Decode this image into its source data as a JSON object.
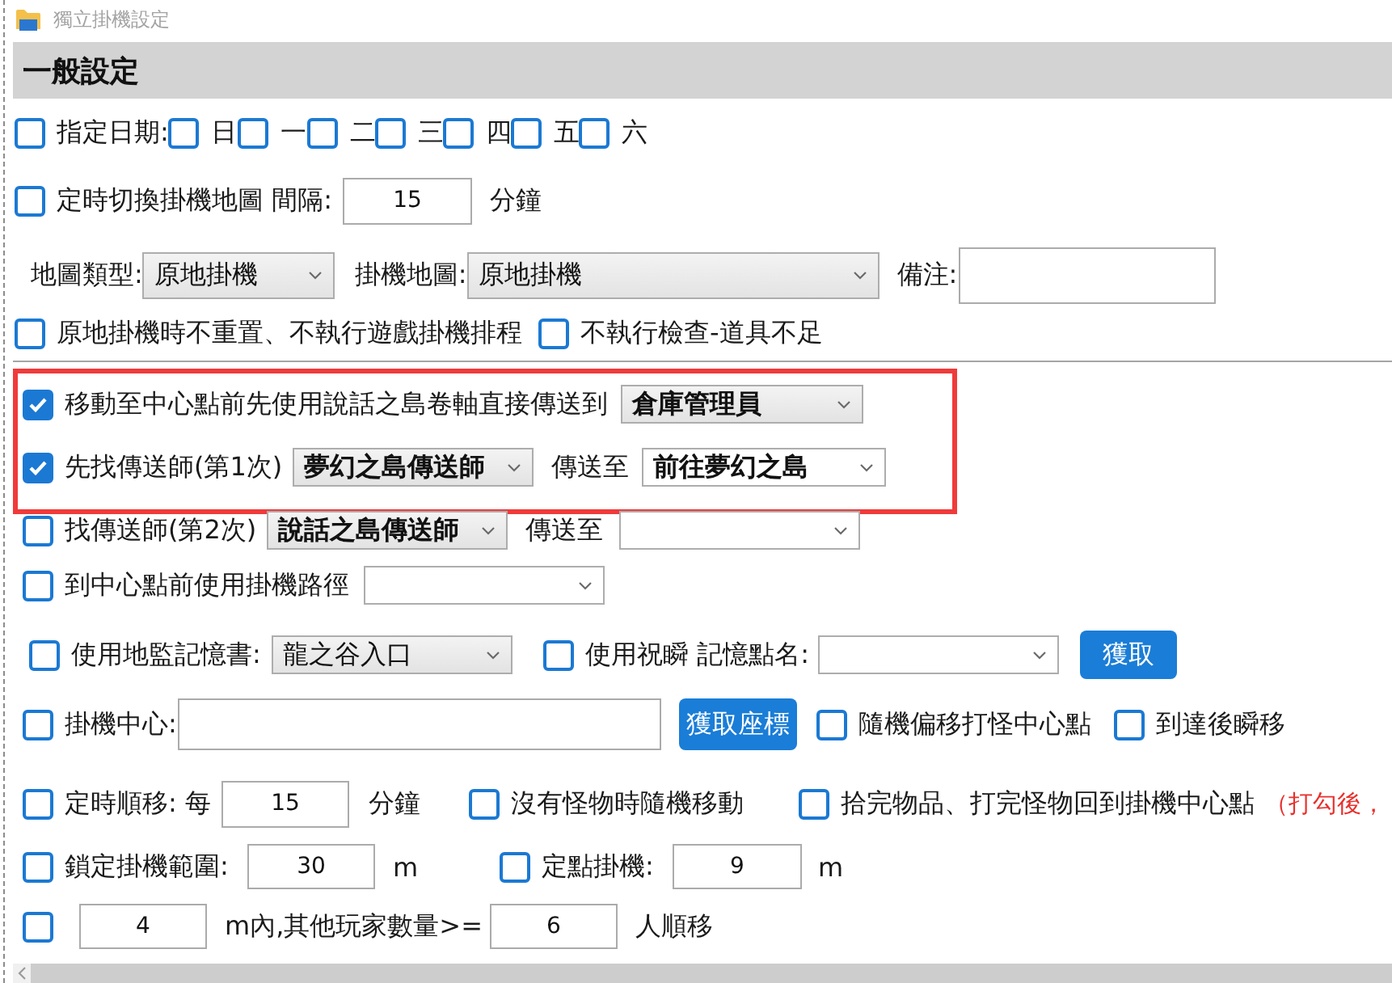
{
  "window": {
    "title": "獨立掛機設定"
  },
  "section": {
    "title": "一般設定"
  },
  "blocks": [
    {
      "highlighted": false,
      "rows": [
        {
          "items": [
            {
              "kind": "checkbox",
              "label": "指定日期:",
              "checked": false
            },
            {
              "kind": "checkbox",
              "label": "日",
              "checked": false
            },
            {
              "kind": "checkbox",
              "label": "一",
              "checked": false
            },
            {
              "kind": "checkbox",
              "label": "二",
              "checked": false
            },
            {
              "kind": "checkbox",
              "label": "三",
              "checked": false
            },
            {
              "kind": "checkbox",
              "label": "四",
              "checked": false
            },
            {
              "kind": "checkbox",
              "label": "五",
              "checked": false
            },
            {
              "kind": "checkbox",
              "label": "六",
              "checked": false
            }
          ]
        },
        {
          "items": [
            {
              "kind": "checkbox",
              "label": "定時切換掛機地圖 間隔:",
              "checked": false
            },
            {
              "kind": "input",
              "value": "15"
            },
            {
              "kind": "label",
              "text": "分鐘"
            }
          ]
        },
        {
          "items": [
            {
              "kind": "label",
              "text": "地圖類型:"
            },
            {
              "kind": "select",
              "value": "原地掛機",
              "bold": false,
              "editable": false
            },
            {
              "kind": "label",
              "text": "掛機地圖:"
            },
            {
              "kind": "select",
              "value": "原地掛機",
              "bold": false,
              "editable": false
            },
            {
              "kind": "label",
              "text": "備注:"
            },
            {
              "kind": "input"
            }
          ]
        },
        {
          "items": [
            {
              "kind": "checkbox",
              "label": "原地掛機時不重置、不執行遊戲掛機排程",
              "checked": false
            },
            {
              "kind": "checkbox",
              "label": "不執行檢查-道具不足",
              "checked": false
            }
          ]
        }
      ]
    },
    {
      "highlighted": true,
      "rows": [
        {
          "items": [
            {
              "kind": "checkbox",
              "label": "移動至中心點前先使用說話之島卷軸直接傳送到",
              "checked": true
            },
            {
              "kind": "select",
              "value": "倉庫管理員",
              "bold": true,
              "editable": false
            }
          ]
        },
        {
          "items": [
            {
              "kind": "checkbox",
              "label": "先找傳送師(第1次)",
              "checked": true
            },
            {
              "kind": "select",
              "value": "夢幻之島傳送師",
              "bold": true,
              "editable": false
            },
            {
              "kind": "label",
              "text": "傳送至"
            },
            {
              "kind": "select",
              "value": "前往夢幻之島",
              "bold": true,
              "editable": true
            }
          ]
        }
      ]
    },
    {
      "highlighted": false,
      "rows": [
        {
          "items": [
            {
              "kind": "checkbox",
              "label": "找傳送師(第2次)",
              "checked": false
            },
            {
              "kind": "select",
              "value": "說話之島傳送師",
              "bold": true,
              "editable": false
            },
            {
              "kind": "label",
              "text": "傳送至"
            },
            {
              "kind": "select",
              "editable": true
            }
          ]
        },
        {
          "items": [
            {
              "kind": "checkbox",
              "label": "到中心點前使用掛機路徑",
              "checked": false
            },
            {
              "kind": "select",
              "editable": true
            }
          ]
        },
        {
          "items": [
            {
              "kind": "checkbox",
              "label": "使用地監記憶書:",
              "checked": false
            },
            {
              "kind": "select",
              "value": "龍之谷入口",
              "bold": false,
              "editable": false
            },
            {
              "kind": "checkbox",
              "label": "使用祝瞬 記憶點名:",
              "checked": false
            },
            {
              "kind": "select",
              "editable": true
            },
            {
              "kind": "button",
              "label": "獲取"
            }
          ]
        },
        {
          "items": [
            {
              "kind": "checkbox",
              "label": "掛機中心:",
              "checked": false
            },
            {
              "kind": "input"
            },
            {
              "kind": "button",
              "label": "獲取座標"
            },
            {
              "kind": "checkbox",
              "label": "隨機偏移打怪中心點",
              "checked": false
            },
            {
              "kind": "checkbox",
              "label": "到達後瞬移",
              "checked": false
            }
          ]
        },
        {
          "items": [
            {
              "kind": "checkbox",
              "label": "定時順移: 每",
              "checked": false
            },
            {
              "kind": "input",
              "value": "15"
            },
            {
              "kind": "label",
              "text": "分鐘"
            },
            {
              "kind": "checkbox",
              "label": "沒有怪物時隨機移動",
              "checked": false
            },
            {
              "kind": "checkbox",
              "label": "拾完物品、打完怪物回到掛機中心點",
              "checked": false
            },
            {
              "kind": "note",
              "text": "（打勾後，"
            }
          ]
        },
        {
          "items": [
            {
              "kind": "checkbox",
              "label": "鎖定掛機範圍:",
              "checked": false
            },
            {
              "kind": "input",
              "value": "30"
            },
            {
              "kind": "label",
              "text": "m"
            },
            {
              "kind": "checkbox",
              "label": "定點掛機:",
              "checked": false
            },
            {
              "kind": "input",
              "value": "9"
            },
            {
              "kind": "label",
              "text": "m"
            }
          ]
        },
        {
          "items": [
            {
              "kind": "checkbox",
              "checked": false
            },
            {
              "kind": "input",
              "value": "4"
            },
            {
              "kind": "label",
              "text": "m內,其他玩家數量>="
            },
            {
              "kind": "input",
              "value": "6"
            },
            {
              "kind": "label",
              "text": "人順移"
            }
          ]
        }
      ]
    }
  ]
}
